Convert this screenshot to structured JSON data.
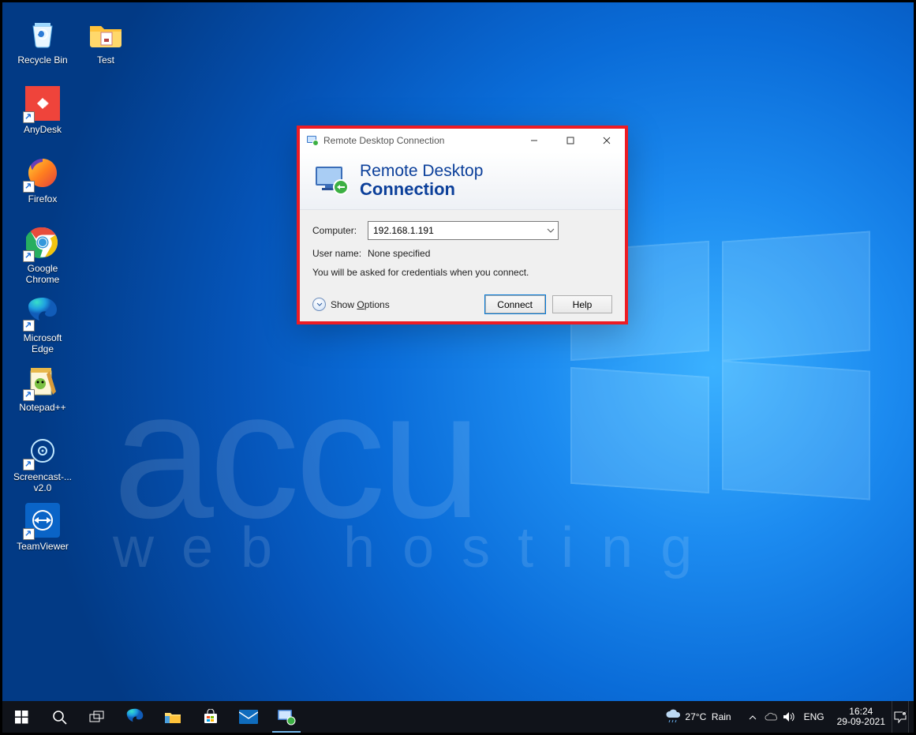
{
  "desktop_icons_col1": [
    {
      "name": "recycle-bin",
      "label": "Recycle Bin"
    },
    {
      "name": "anydesk",
      "label": "AnyDesk"
    },
    {
      "name": "firefox",
      "label": "Firefox"
    },
    {
      "name": "google-chrome",
      "label": "Google Chrome"
    },
    {
      "name": "microsoft-edge",
      "label": "Microsoft Edge"
    },
    {
      "name": "notepadpp",
      "label": "Notepad++"
    },
    {
      "name": "screencast",
      "label": "Screencast-... v2.0"
    },
    {
      "name": "teamviewer",
      "label": "TeamViewer"
    }
  ],
  "desktop_icons_col2": [
    {
      "name": "test-folder",
      "label": "Test"
    }
  ],
  "dialog": {
    "title": "Remote Desktop Connection",
    "banner_line1": "Remote Desktop",
    "banner_line2": "Connection",
    "computer_label": "Computer:",
    "computer_value": "192.168.1.191",
    "username_label": "User name:",
    "username_value": "None specified",
    "hint": "You will be asked for credentials when you connect.",
    "show_options": "Show Options",
    "connect": "Connect",
    "help": "Help"
  },
  "tray": {
    "weather_temp": "27°C",
    "weather_cond": "Rain",
    "lang": "ENG",
    "time": "16:24",
    "date": "29-09-2021"
  },
  "watermark": {
    "brand": "accu",
    "sub": "web hosting"
  }
}
